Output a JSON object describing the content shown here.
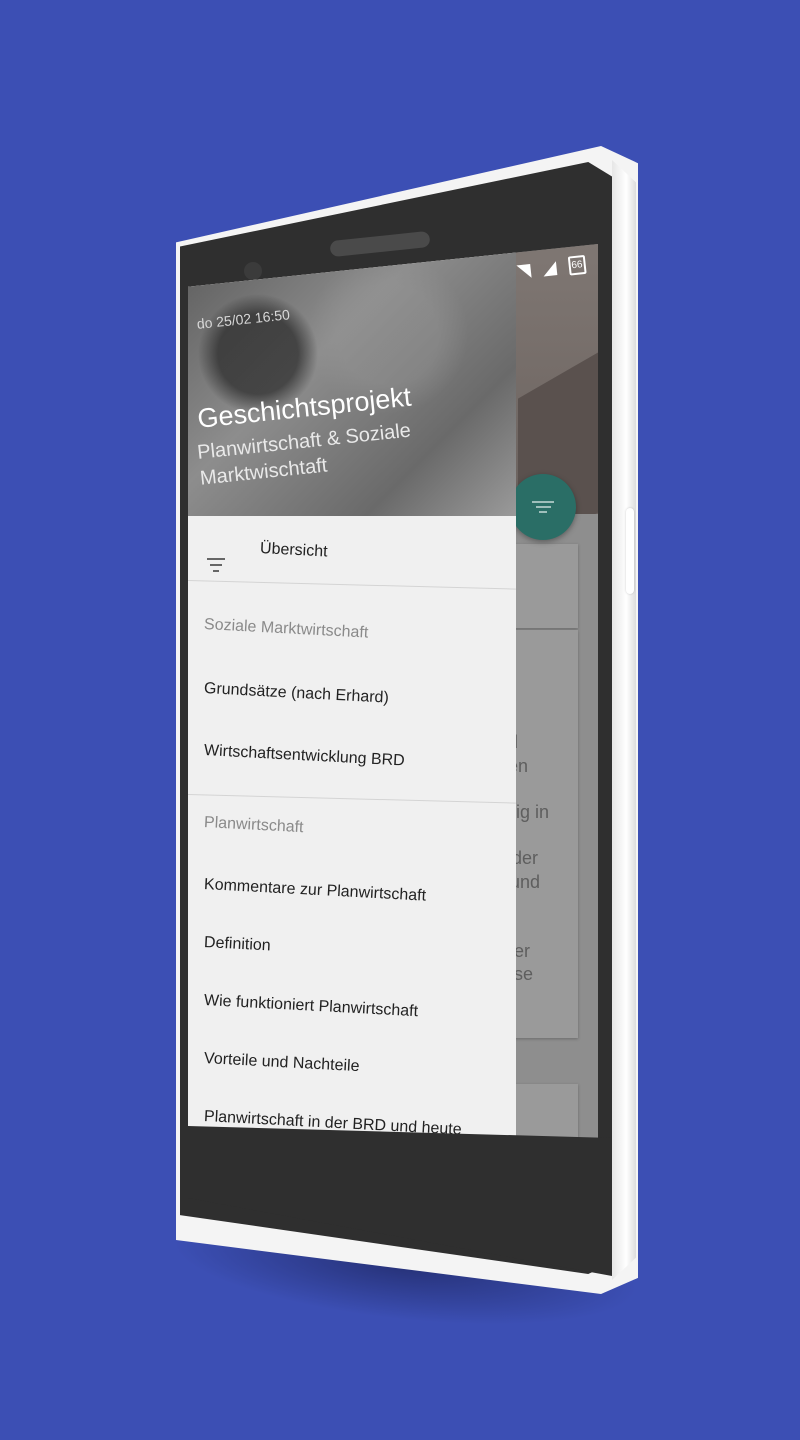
{
  "status_bar": {
    "bluetooth_icon": "bluetooth-icon",
    "vibrate_icon": "vibrate-icon",
    "wifi_icon": "wifi-icon",
    "signal_icon": "signal-icon",
    "battery_level": "66"
  },
  "drawer": {
    "date_time": "do 25/02 16:50",
    "title": "Geschichtsprojekt",
    "subtitle": "Planwirtschaft & Soziale Marktwischtaft",
    "overview": {
      "icon": "filter-list-icon",
      "label": "Übersicht"
    },
    "sections": [
      {
        "heading": "Soziale Marktwirtschaft",
        "items": [
          "Grundsätze (nach Erhard)",
          "Wirtschaftsentwicklung BRD"
        ]
      },
      {
        "heading": "Planwirtschaft",
        "items": [
          "Kommentare zur Planwirtschaft",
          "Definition",
          "Wie funktioniert Planwirtschaft",
          "Vorteile und Nachteile",
          "Planwirtschaft in der BRD und heute"
        ]
      }
    ]
  },
  "background": {
    "fab_icon": "filter-list-icon",
    "text_fragments": [
      "d",
      "en",
      "eig in",
      "der",
      "und",
      "r",
      "ler",
      "ise"
    ]
  },
  "colors": {
    "page_background": "#3c4fb4",
    "accent": "#2a6e66",
    "drawer": "#f0f0f0"
  }
}
